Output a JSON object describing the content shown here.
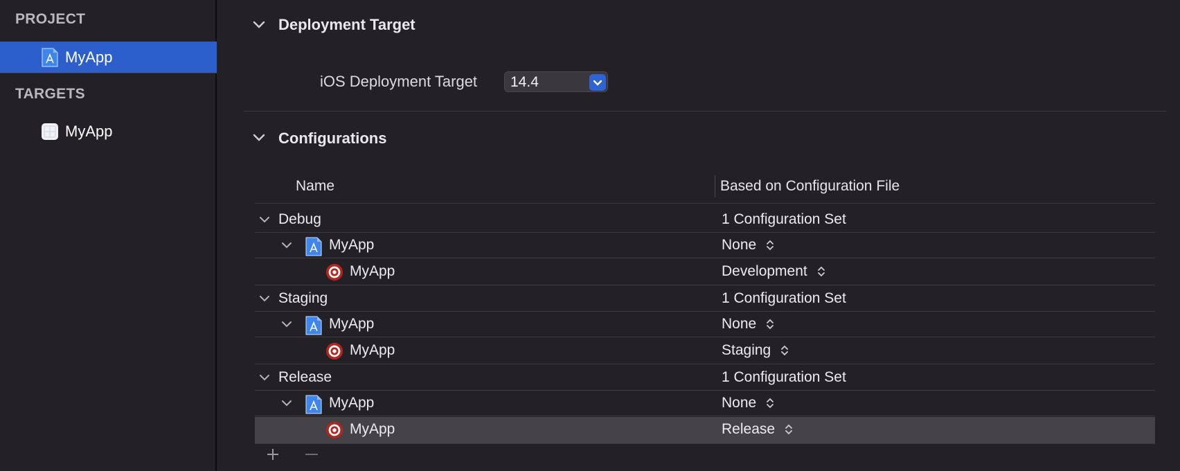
{
  "sidebar": {
    "project_header": "PROJECT",
    "project_item": {
      "label": "MyApp",
      "icon": "project-file-icon"
    },
    "targets_header": "TARGETS",
    "target_item": {
      "label": "MyApp",
      "icon": "app-target-icon"
    }
  },
  "deployment": {
    "title": "Deployment Target",
    "label": "iOS Deployment Target",
    "value": "14.4"
  },
  "configurations": {
    "title": "Configurations",
    "columns": [
      "Name",
      "Based on Configuration File"
    ],
    "rows": [
      {
        "level": 0,
        "name": "Debug",
        "value": "1 Configuration Set"
      },
      {
        "level": 1,
        "name": "MyApp",
        "icon": "project-file-icon",
        "value": "None"
      },
      {
        "level": 2,
        "name": "MyApp",
        "icon": "target-icon",
        "value": "Development"
      },
      {
        "level": 0,
        "name": "Staging",
        "value": "1 Configuration Set"
      },
      {
        "level": 1,
        "name": "MyApp",
        "icon": "project-file-icon",
        "value": "None"
      },
      {
        "level": 2,
        "name": "MyApp",
        "icon": "target-icon",
        "value": "Staging"
      },
      {
        "level": 0,
        "name": "Release",
        "value": "1 Configuration Set"
      },
      {
        "level": 1,
        "name": "MyApp",
        "icon": "project-file-icon",
        "value": "None"
      },
      {
        "level": 2,
        "name": "MyApp",
        "icon": "target-icon",
        "value": "Release",
        "selected": true
      }
    ],
    "add_label": "+",
    "remove_label": "—"
  },
  "colors": {
    "accent": "#2d5fcc",
    "background": "#232125",
    "target_red": "#b3261e"
  }
}
